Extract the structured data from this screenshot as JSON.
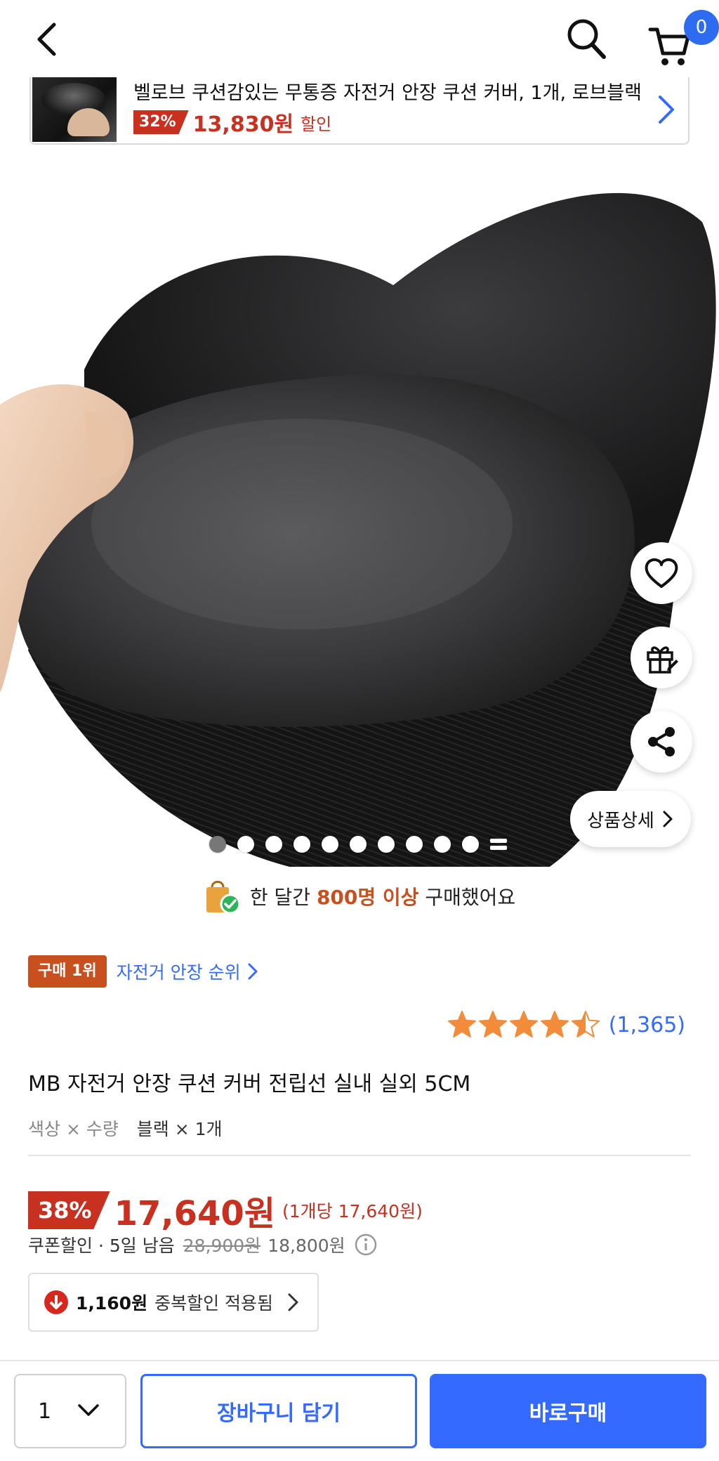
{
  "header": {
    "cart_count": "0"
  },
  "recent_item": {
    "title": "벨로브 쿠션감있는 무통증 자전거 안장 쿠션 커버, 1개, 로브블랙",
    "discount": "32%",
    "price": "13,830원",
    "sale_label": "할인"
  },
  "gallery": {
    "detail_label": "상품상세",
    "image_count": 10,
    "active_index": 0
  },
  "buyers": {
    "prefix": "한 달간",
    "highlight": "800명 이상",
    "suffix": "구매했어요"
  },
  "rank": {
    "badge": "구매 1위",
    "link": "자전거 안장 순위"
  },
  "rating": {
    "stars": 4.5,
    "count": "(1,365)"
  },
  "product": {
    "title": "MB 자전거 안장 쿠션 커버 전립선 실내 실외 5CM",
    "option_label": "색상 × 수량",
    "option_value": "블랙 × 1개"
  },
  "price": {
    "discount": "38%",
    "main": "17,640원",
    "unit": "(1개당 17,640원)"
  },
  "coupon": {
    "label": "쿠폰할인 · 5일 남음",
    "original": "28,900원",
    "price": "18,800원"
  },
  "duplicate_discount": {
    "amount": "1,160원",
    "text": "중복할인 적용됨"
  },
  "bottom": {
    "quantity": "1",
    "cart_label": "장바구니 담기",
    "buy_label": "바로구매"
  },
  "colors": {
    "accent": "#346aff",
    "discount_red": "#c8311f",
    "rank_orange": "#c8501f",
    "star": "#f28b3a"
  }
}
